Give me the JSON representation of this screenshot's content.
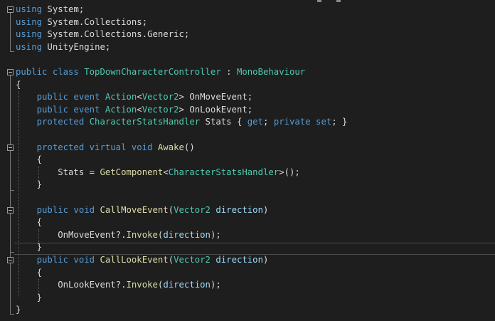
{
  "editor": {
    "lines": [
      [
        {
          "t": "using",
          "c": "kw"
        },
        {
          "t": " System;",
          "c": "pl"
        }
      ],
      [
        {
          "t": "using",
          "c": "kw"
        },
        {
          "t": " System.Collections;",
          "c": "pl"
        }
      ],
      [
        {
          "t": "using",
          "c": "kw"
        },
        {
          "t": " System.Collections.Generic;",
          "c": "pl"
        }
      ],
      [
        {
          "t": "using",
          "c": "kw"
        },
        {
          "t": " UnityEngine;",
          "c": "pl"
        }
      ],
      [],
      [
        {
          "t": "public class ",
          "c": "kw"
        },
        {
          "t": "TopDownCharacterController",
          "c": "ty"
        },
        {
          "t": " : ",
          "c": "pl"
        },
        {
          "t": "MonoBehaviour",
          "c": "ty"
        }
      ],
      [
        {
          "t": "{",
          "c": "pl"
        }
      ],
      [
        {
          "t": "    public event ",
          "c": "kw"
        },
        {
          "t": "Action",
          "c": "ty"
        },
        {
          "t": "<",
          "c": "pl"
        },
        {
          "t": "Vector2",
          "c": "ty"
        },
        {
          "t": "> OnMoveEvent;",
          "c": "pl"
        }
      ],
      [
        {
          "t": "    public event ",
          "c": "kw"
        },
        {
          "t": "Action",
          "c": "ty"
        },
        {
          "t": "<",
          "c": "pl"
        },
        {
          "t": "Vector2",
          "c": "ty"
        },
        {
          "t": "> OnLookEvent;",
          "c": "pl"
        }
      ],
      [
        {
          "t": "    protected ",
          "c": "kw"
        },
        {
          "t": "CharacterStatsHandler",
          "c": "ty"
        },
        {
          "t": " Stats { ",
          "c": "pl"
        },
        {
          "t": "get",
          "c": "kw"
        },
        {
          "t": "; ",
          "c": "pl"
        },
        {
          "t": "private set",
          "c": "kw"
        },
        {
          "t": "; }",
          "c": "pl"
        }
      ],
      [],
      [
        {
          "t": "    protected virtual void ",
          "c": "kw"
        },
        {
          "t": "Awake",
          "c": "mt"
        },
        {
          "t": "()",
          "c": "pl"
        }
      ],
      [
        {
          "t": "    {",
          "c": "pl"
        }
      ],
      [
        {
          "t": "        Stats = ",
          "c": "pl"
        },
        {
          "t": "GetComponent",
          "c": "mt"
        },
        {
          "t": "<",
          "c": "pl"
        },
        {
          "t": "CharacterStatsHandler",
          "c": "ty"
        },
        {
          "t": ">();",
          "c": "pl"
        }
      ],
      [
        {
          "t": "    }",
          "c": "pl"
        }
      ],
      [],
      [
        {
          "t": "    public void ",
          "c": "kw"
        },
        {
          "t": "CallMoveEvent",
          "c": "mt"
        },
        {
          "t": "(",
          "c": "pl"
        },
        {
          "t": "Vector2",
          "c": "ty"
        },
        {
          "t": " direction",
          "c": "pr"
        },
        {
          "t": ")",
          "c": "pl"
        }
      ],
      [
        {
          "t": "    {",
          "c": "pl"
        }
      ],
      [
        {
          "t": "        OnMoveEvent?.",
          "c": "pl"
        },
        {
          "t": "Invoke",
          "c": "mt"
        },
        {
          "t": "(",
          "c": "pl"
        },
        {
          "t": "direction",
          "c": "pr"
        },
        {
          "t": ");",
          "c": "pl"
        }
      ],
      [
        {
          "t": "    }",
          "c": "pl"
        }
      ],
      [
        {
          "t": "    public void ",
          "c": "kw"
        },
        {
          "t": "CallLookEvent",
          "c": "mt"
        },
        {
          "t": "(",
          "c": "pl"
        },
        {
          "t": "Vector2",
          "c": "ty"
        },
        {
          "t": " direction",
          "c": "pr"
        },
        {
          "t": ")",
          "c": "pl"
        }
      ],
      [
        {
          "t": "    {",
          "c": "pl"
        }
      ],
      [
        {
          "t": "        OnLookEvent?.",
          "c": "pl"
        },
        {
          "t": "Invoke",
          "c": "mt"
        },
        {
          "t": "(",
          "c": "pl"
        },
        {
          "t": "direction",
          "c": "pr"
        },
        {
          "t": ");",
          "c": "pl"
        }
      ],
      [
        {
          "t": "    }",
          "c": "pl"
        }
      ],
      [
        {
          "t": "}",
          "c": "pl"
        }
      ]
    ]
  }
}
